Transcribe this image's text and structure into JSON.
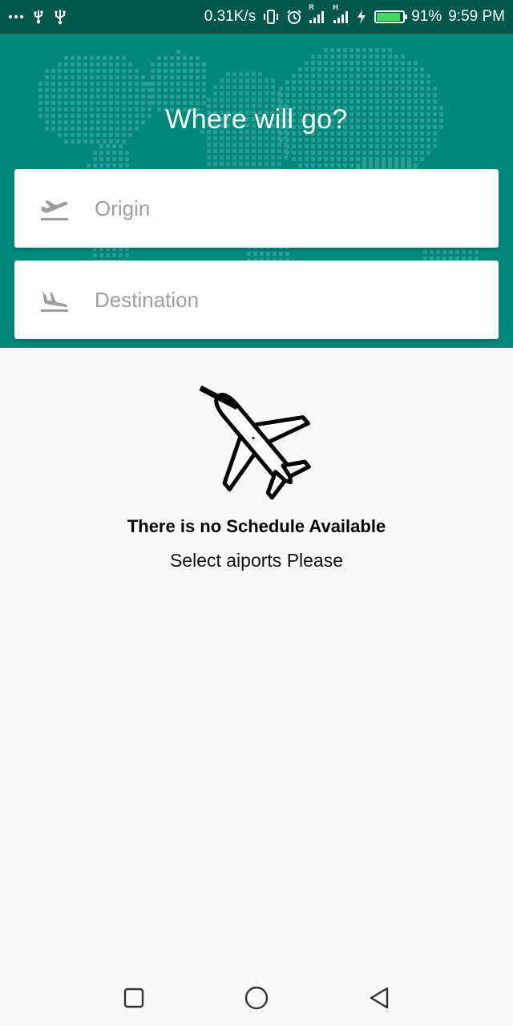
{
  "status_bar": {
    "left_icons": [
      "more-dots-icon",
      "usb-debug-icon",
      "usb-icon"
    ],
    "net_speed": "0.31K/s",
    "sim1_label": "R",
    "sim2_label": "H",
    "battery_percent": "91%",
    "battery_level": 0.91,
    "time": "9:59 PM"
  },
  "header": {
    "title": "Where will go?",
    "background_color": "#00897b",
    "origin": {
      "placeholder": "Origin",
      "icon": "flight-takeoff-icon"
    },
    "destination": {
      "placeholder": "Destination",
      "icon": "flight-land-icon"
    }
  },
  "empty_state": {
    "icon": "airplane-icon",
    "title": "There is no Schedule Available",
    "subtitle": "Select aiports Please"
  },
  "nav_bar": {
    "items": [
      "recents-button",
      "home-button",
      "back-button"
    ]
  }
}
